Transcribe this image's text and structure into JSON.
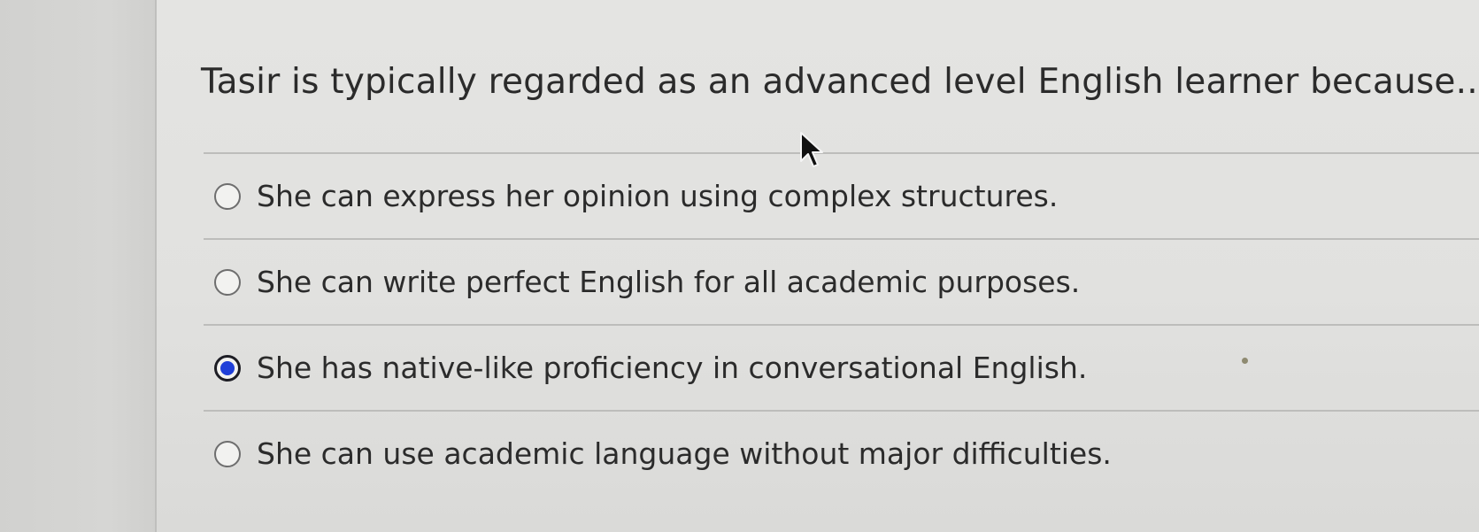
{
  "question": {
    "text": "Tasir is typically regarded as an advanced level English learner because..."
  },
  "options": [
    {
      "label": "She can express her opinion using complex structures.",
      "selected": false
    },
    {
      "label": "She can write perfect English for all academic purposes.",
      "selected": false
    },
    {
      "label": "She has native-like proficiency in conversational English.",
      "selected": true
    },
    {
      "label": "She can use academic language without major difficulties.",
      "selected": false
    }
  ],
  "colors": {
    "selected_radio": "#1f3fd8",
    "text": "#2b2b2b",
    "background": "#e2e2e0"
  },
  "icons": {
    "cursor": "mouse-pointer-arrow-icon"
  }
}
